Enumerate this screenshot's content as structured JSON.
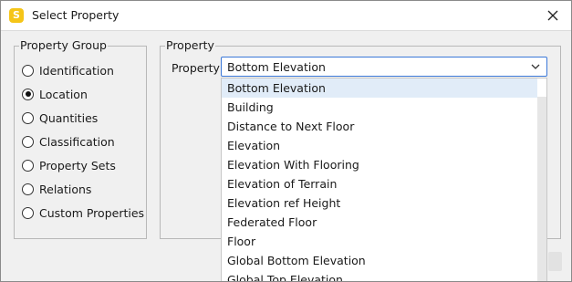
{
  "window": {
    "title": "Select Property",
    "app_icon_letter": "S"
  },
  "property_group": {
    "legend": "Property Group",
    "options": [
      {
        "label": "Identification",
        "checked": false
      },
      {
        "label": "Location",
        "checked": true
      },
      {
        "label": "Quantities",
        "checked": false
      },
      {
        "label": "Classification",
        "checked": false
      },
      {
        "label": "Property Sets",
        "checked": false
      },
      {
        "label": "Relations",
        "checked": false
      },
      {
        "label": "Custom Properties",
        "checked": false
      }
    ]
  },
  "property": {
    "legend": "Property",
    "field_label": "Property",
    "selected_value": "Bottom Elevation",
    "dropdown_items": [
      "Bottom Elevation",
      "Building",
      "Distance to Next Floor",
      "Elevation",
      "Elevation With Flooring",
      "Elevation of Terrain",
      "Elevation ref Height",
      "Federated Floor",
      "Floor",
      "Global Bottom Elevation",
      "Global Top Elevation"
    ],
    "highlighted_index": 0
  },
  "colors": {
    "accent_border": "#3b78d8",
    "highlight": "#e1ecf8",
    "app_icon": "#f5c518"
  }
}
